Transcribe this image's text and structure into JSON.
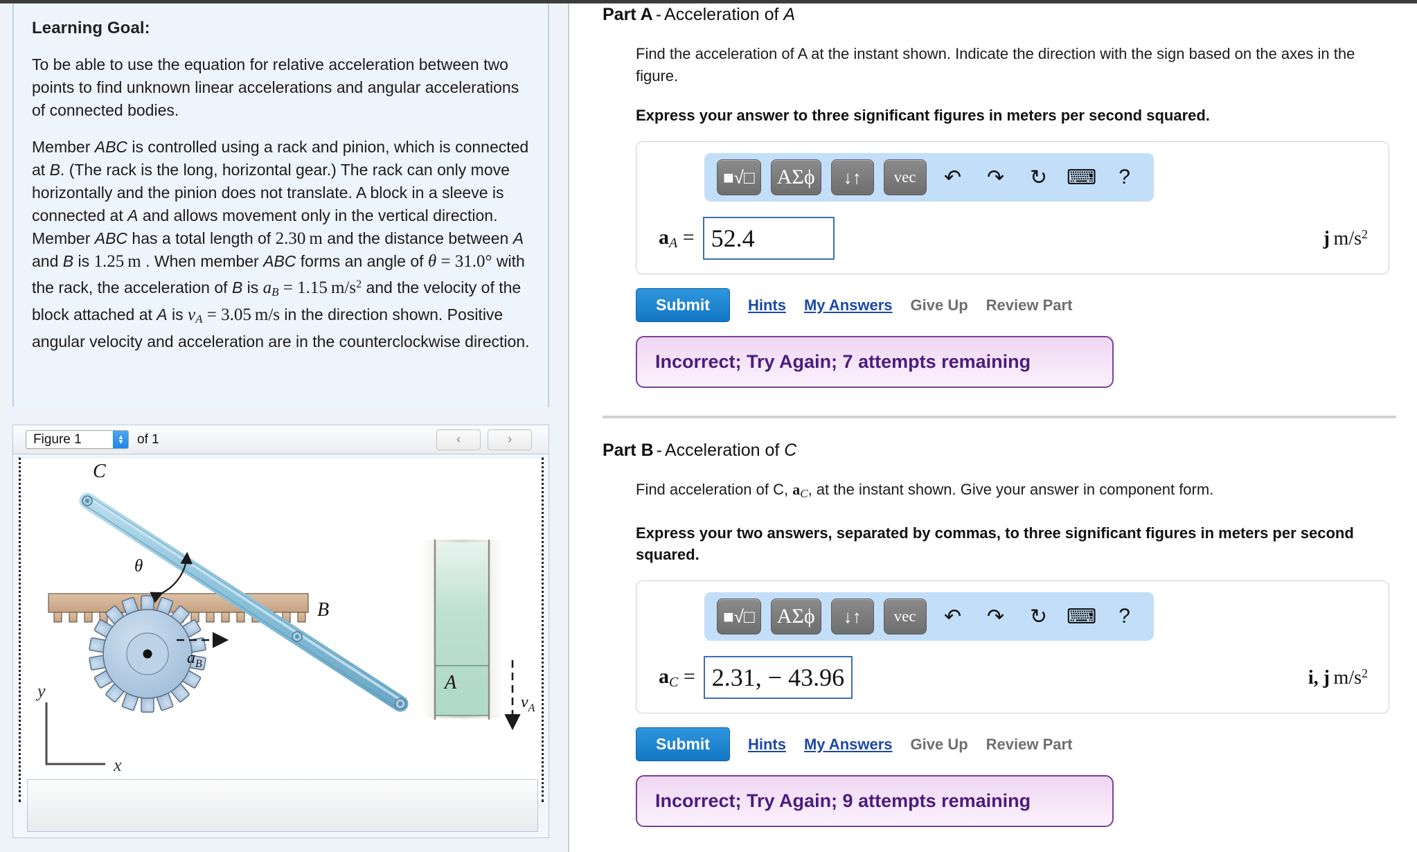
{
  "left": {
    "learning_goal_title": "Learning Goal:",
    "paragraph1": "To be able to use the equation for relative acceleration between two points to find unknown linear accelerations and angular accelerations of connected bodies.",
    "paragraph2_parts": {
      "a": "Member ",
      "abc1": "ABC",
      "b": " is controlled using a rack and pinion, which is connected at ",
      "bLetter": "B",
      "c": ". (The rack is the long, horizontal gear.) The rack can only move horizontally and the pinion does not translate. A block in a sleeve is connected at ",
      "aLetter": "A",
      "d": " and allows movement only in the vertical direction. Member ",
      "abc2": "ABC",
      "e": " has a total length of ",
      "len": "2.30 m",
      "f": " and the distance between ",
      "aLetter2": "A",
      "g": " and ",
      "bLetter2": "B",
      "h": " is ",
      "dist": "1.25 m",
      "i": " . When member ",
      "abc3": "ABC",
      "j": " forms an angle of ",
      "theta_eq": "θ = 31.0°",
      "k": " with the rack, the acceleration of ",
      "bLetter3": "B",
      "l": " is ",
      "aB_eq": "a_B = 1.15 m/s²",
      "m": " and the velocity of the block attached at ",
      "aLetter3": "A",
      "n": " is ",
      "vA_eq": "v_A = 3.05 m/s",
      "o": " in the direction shown. Positive angular velocity and acceleration are in the counterclockwise direction."
    },
    "values": {
      "total_length": "2.30",
      "length_unit": "m",
      "distance_AB": "1.25",
      "theta_symbol": "θ",
      "theta_value": "31.0°",
      "aB_symbol": "a",
      "aB_sub": "B",
      "aB_value": "1.15",
      "aB_unit_num": "m",
      "aB_unit_den": "s",
      "aB_unit_exp": "2",
      "vA_symbol": "v",
      "vA_sub": "A",
      "vA_value": "3.05",
      "vA_unit_num": "m",
      "vA_unit_den": "s"
    },
    "figure_selector": {
      "selected": "Figure 1",
      "of_text": "of 1",
      "prev_icon": "‹",
      "next_icon": "›",
      "up_arrow": "▴",
      "down_arrow": "▾"
    },
    "figure_labels": {
      "C": "C",
      "B": "B",
      "A": "A",
      "theta": "θ",
      "aB": "a",
      "aB_sub": "B",
      "vA": "v",
      "vA_sub": "A",
      "x_axis": "x",
      "y_axis": "y"
    }
  },
  "mathbar": {
    "buttons": [
      {
        "name": "template-sqrt",
        "glyph": "■√□"
      },
      {
        "name": "greek-letters",
        "glyph": "ΑΣϕ"
      },
      {
        "name": "updown-arrows",
        "glyph": "↓↑"
      },
      {
        "name": "vector",
        "glyph": "vec"
      }
    ],
    "icons": [
      {
        "name": "undo-icon",
        "glyph": "↶"
      },
      {
        "name": "redo-icon",
        "glyph": "↷"
      },
      {
        "name": "reset-icon",
        "glyph": "↻"
      },
      {
        "name": "keyboard-icon",
        "glyph": "⌨"
      },
      {
        "name": "help-icon",
        "glyph": "?"
      }
    ]
  },
  "partA": {
    "label": "Part A",
    "dash": "-",
    "title": "Acceleration of A",
    "question": "Find the acceleration of A at the instant shown. Indicate the direction with the sign based on the axes in the figure.",
    "instruction": "Express your answer to three significant figures in meters per second squared.",
    "answer_symbol": "a",
    "answer_sub": "A",
    "answer_equals": "=",
    "answer_value": "52.4",
    "units": "j m/s",
    "units_exp": "2",
    "units_vector": "j",
    "submit_label": "Submit",
    "hints_label": "Hints",
    "my_answers_label": "My Answers",
    "give_up_label": "Give Up",
    "review_part_label": "Review Part",
    "feedback": "Incorrect; Try Again; 7 attempts remaining"
  },
  "partB": {
    "label": "Part B",
    "dash": "-",
    "title": "Acceleration of C",
    "question_pre": "Find acceleration of C, ",
    "question_symbol": "a",
    "question_sub": "C",
    "question_post": ", at the instant shown. Give your answer in component form.",
    "instruction": "Express your two answers, separated by commas, to three significant figures in meters per second squared.",
    "answer_symbol": "a",
    "answer_sub": "C",
    "answer_equals": "=",
    "answer_value": "2.31, − 43.96",
    "units_vector": "i, j",
    "units": "m/s",
    "units_exp": "2",
    "submit_label": "Submit",
    "hints_label": "Hints",
    "my_answers_label": "My Answers",
    "give_up_label": "Give Up",
    "review_part_label": "Review Part",
    "feedback": "Incorrect; Try Again; 9 attempts remaining"
  },
  "colors": {
    "accent_blue": "#1377c4",
    "link_blue": "#1c48a8",
    "feedback_border": "#7b3f9d",
    "feedback_text": "#4b1d7c",
    "rack_tan": "#ccab8c",
    "member_blue": "#8fc3dd",
    "gear_blue": "#a8c4de",
    "sleeve_green": "#b9ded0"
  }
}
